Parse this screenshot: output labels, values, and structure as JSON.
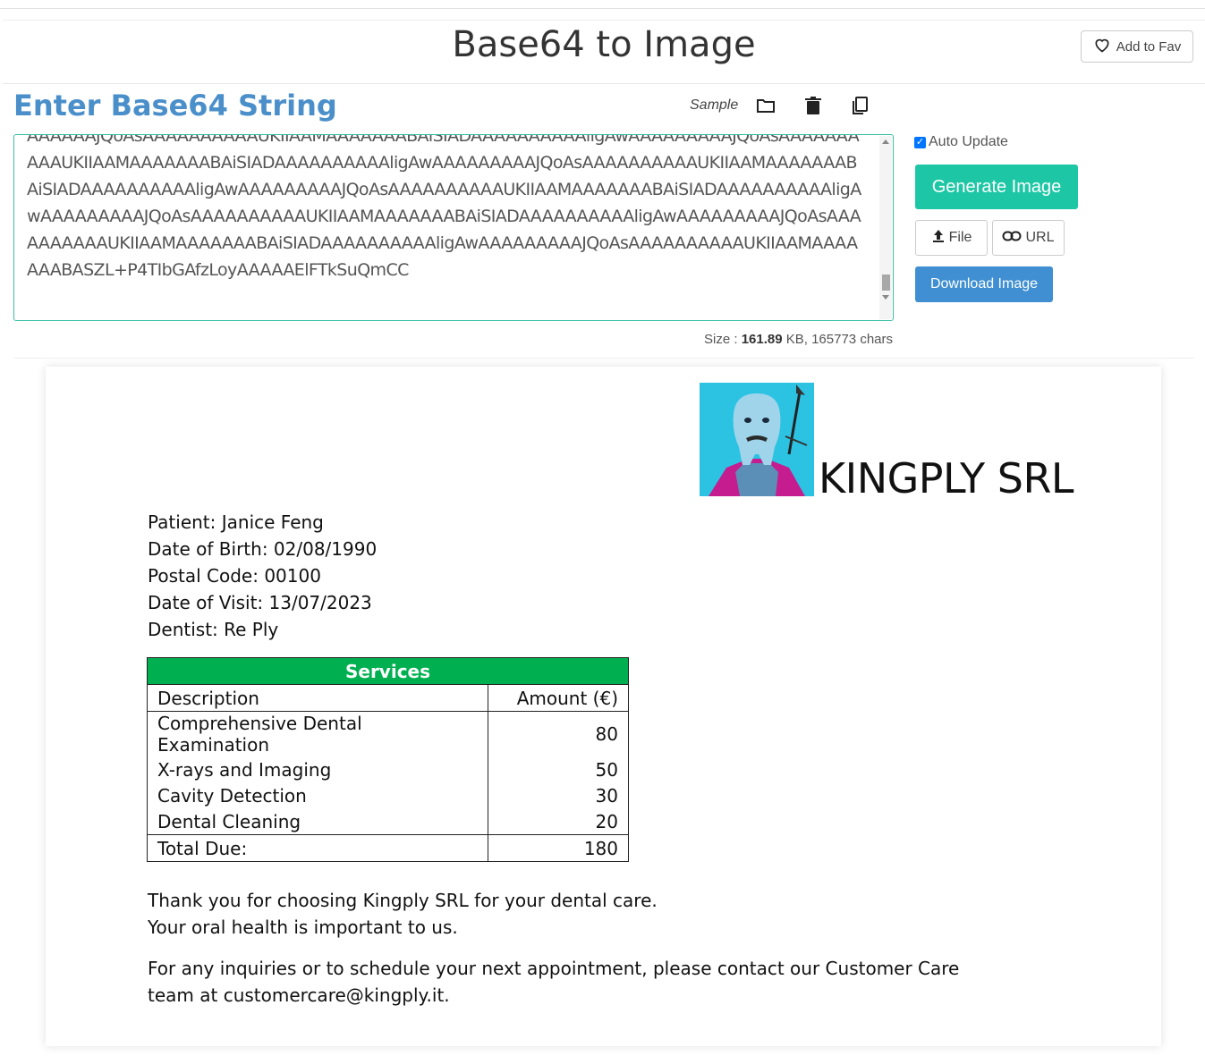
{
  "header": {
    "title": "Base64 to Image",
    "fav_label": "Add to Fav"
  },
  "editor": {
    "section_title": "Enter Base64 String",
    "sample_label": "Sample",
    "content": "AAAAAAJQoAsAAAAAAAAAAUKIIAAMAAAAAAABAiSIADAAAAAAAAAAligAwAAAAAAAAAJQoAsAAAAAAAAAAUKIIAAMAAAAAAABAiSIADAAAAAAAAAAligAwAAAAAAAAAJQoAsAAAAAAAAAAUKIIAAMAAAAAAABAiSIADAAAAAAAAAAligAwAAAAAAAAAJQoAsAAAAAAAAAAUKIIAAMAAAAAAABAiSIADAAAAAAAAAAligAwAAAAAAAAAJQoAsAAAAAAAAAAUKIIAAMAAAAAAABAiSIADAAAAAAAAAAligAwAAAAAAAAAJQoAsAAAAAAAAAAUKIIAAMAAAAAAABAiSIADAAAAAAAAAAligAwAAAAAAAAAJQoAsAAAAAAAAAAUKIIAAMAAAAAAABASZL+P4TIbGAfzLoyAAAAAElFTkSuQmCC",
    "size_prefix": "Size :",
    "size_value": "161.89",
    "size_suffix": "KB, 165773 chars"
  },
  "controls": {
    "auto_update_label": "Auto Update",
    "auto_update_checked": true,
    "generate_label": "Generate Image",
    "file_label": "File",
    "url_label": "URL",
    "download_label": "Download Image"
  },
  "document": {
    "company": "KINGPLY SRL",
    "info": [
      "Patient: Janice Feng",
      "Date of Birth: 02/08/1990",
      "Postal Code: 00100",
      "Date of Visit: 13/07/2023",
      "Dentist: Re Ply"
    ],
    "services_header": "Services",
    "col_description": "Description",
    "col_amount": "Amount (€)",
    "services": [
      {
        "description": "Comprehensive Dental Examination",
        "amount": "80"
      },
      {
        "description": "X-rays and Imaging",
        "amount": "50"
      },
      {
        "description": "Cavity Detection",
        "amount": "30"
      },
      {
        "description": "Dental Cleaning",
        "amount": "20"
      }
    ],
    "total_label": "Total Due:",
    "total_value": "180",
    "thanks_1": "Thank you for choosing Kingply SRL for your dental care.",
    "thanks_2": "Your oral health is important to us.",
    "contact": "For any inquiries or to schedule your next appointment, please contact our Customer Care team at customercare@kingply.it."
  },
  "colors": {
    "accent": "#1dc7a5",
    "title_blue": "#4a8fc9",
    "download_blue": "#3f8fd2",
    "services_green": "#00b050"
  }
}
